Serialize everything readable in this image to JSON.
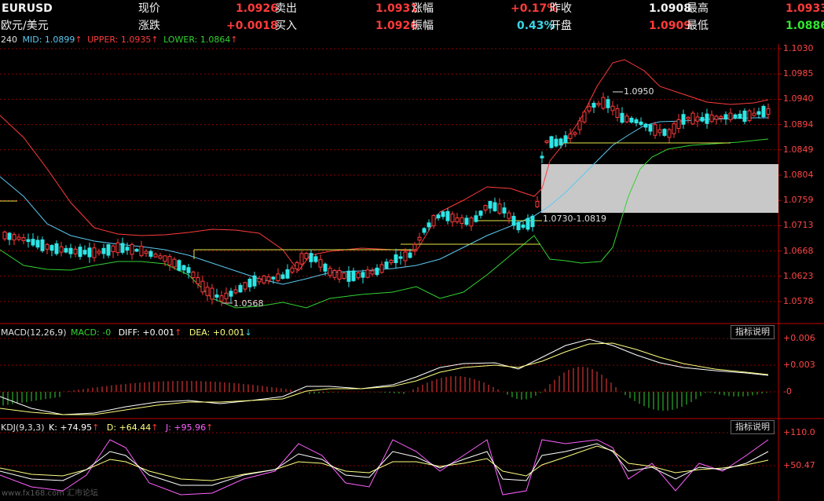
{
  "quote": {
    "symbol": "EURUSD",
    "name": "欧元/美元",
    "row1": [
      {
        "label": "现价",
        "value": "1.0926"
      },
      {
        "label": "卖出",
        "value": "1.0931"
      },
      {
        "label": "涨幅",
        "value": "+0.17%"
      },
      {
        "label": "昨收",
        "value": "1.0908"
      },
      {
        "label": "最高",
        "value": "1.0933"
      }
    ],
    "row2": [
      {
        "label": "涨跌",
        "value": "+0.0018"
      },
      {
        "label": "买入",
        "value": "1.0926"
      },
      {
        "label": "振幅",
        "value": "0.43%"
      },
      {
        "label": "开盘",
        "value": "1.0909"
      },
      {
        "label": "最低",
        "value": "1.0886"
      }
    ]
  },
  "main_panel": {
    "period": "240",
    "mid": "MID: 1.0899",
    "upper": "UPPER: 1.0935",
    "lower": "LOWER: 1.0864",
    "annot_high": "1.0950",
    "annot_low": "1.0568",
    "annot_zone": "1.0730-1.0819",
    "y_ticks": [
      "1.1030",
      "1.0985",
      "1.0940",
      "1.0894",
      "1.0849",
      "1.0804",
      "1.0759",
      "1.0713",
      "1.0668",
      "1.0623",
      "1.0578"
    ]
  },
  "macd_panel": {
    "title": "MACD(12,26,9)",
    "macd": "MACD: -0",
    "diff": "DIFF: +0.001",
    "dea": "DEA: +0.001",
    "button": "指标说明",
    "y_ticks": [
      "+0.006",
      "+0.003",
      "-0"
    ]
  },
  "kdj_panel": {
    "title": "KDJ(9,3,3)",
    "k": "K: +74.95",
    "d": "D: +64.44",
    "j": "J: +95.96",
    "button": "指标说明",
    "y_ticks": [
      "+110.0",
      "+50.47"
    ]
  },
  "watermark": "www.fx168.com 汇市论坛",
  "colors": {
    "up": "#ff3b3b",
    "down": "#2ee6e6",
    "mid": "#5bc8ef",
    "upper": "#ff3b3b",
    "lower": "#32d232",
    "grid": "#8b0000",
    "zone": "#c8c8c8",
    "macd_diff": "#ffffff",
    "macd_dea": "#ffff80",
    "kdj_k": "#ffffff",
    "kdj_d": "#ffff80",
    "kdj_j": "#ff60ff"
  }
}
